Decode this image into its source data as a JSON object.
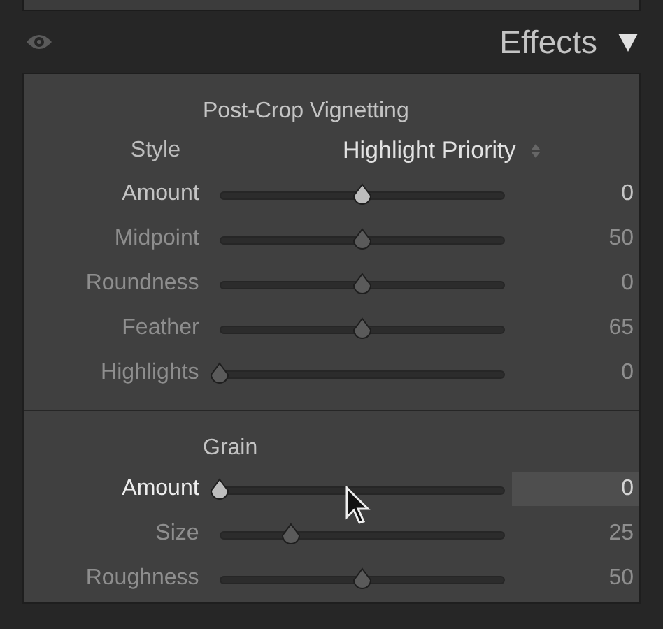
{
  "header": {
    "title": "Effects",
    "expanded": true
  },
  "sections": [
    {
      "title": "Post-Crop Vignetting",
      "style": {
        "label": "Style",
        "value": "Highlight Priority"
      },
      "sliders": [
        {
          "label": "Amount",
          "level": 0.5,
          "reading": "0",
          "disabled": false,
          "active": false
        },
        {
          "label": "Midpoint",
          "level": 0.5,
          "reading": "50",
          "disabled": true,
          "active": false
        },
        {
          "label": "Roundness",
          "level": 0.5,
          "reading": "0",
          "disabled": true,
          "active": false
        },
        {
          "label": "Feather",
          "level": 0.5,
          "reading": "65",
          "disabled": true,
          "active": false
        },
        {
          "label": "Highlights",
          "level": 0,
          "reading": "0",
          "disabled": true,
          "active": false
        }
      ]
    },
    {
      "title": "Grain",
      "sliders": [
        {
          "label": "Amount",
          "level": 0,
          "reading": "0",
          "disabled": false,
          "active": true
        },
        {
          "label": "Size",
          "level": 0.25,
          "reading": "25",
          "disabled": true,
          "active": false
        },
        {
          "label": "Roughness",
          "level": 0.5,
          "reading": "50",
          "disabled": true,
          "active": false
        }
      ]
    }
  ]
}
